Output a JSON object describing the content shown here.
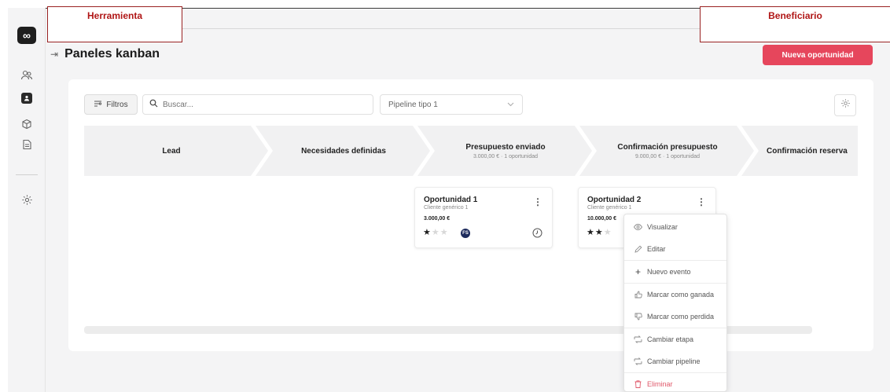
{
  "tags": {
    "left": "Herramienta",
    "right": "Beneficiario"
  },
  "sidebar": {
    "logo": "∞",
    "icons": [
      "contacts-icon",
      "user-card-icon",
      "package-icon",
      "document-icon",
      "settings-icon"
    ]
  },
  "header": {
    "title": "Paneles kanban",
    "new_button": "Nueva oportunidad"
  },
  "toolbar": {
    "filter_label": "Filtros",
    "search_placeholder": "Buscar...",
    "pipeline_value": "Pipeline tipo 1"
  },
  "stages": [
    {
      "name": "Lead",
      "sub": ""
    },
    {
      "name": "Necesidades definidas",
      "sub": ""
    },
    {
      "name": "Presupuesto enviado",
      "sub": "3.000,00 € · 1 oportunidad"
    },
    {
      "name": "Confirmación presupuesto",
      "sub": "9.000,00 € · 1 oportunidad"
    },
    {
      "name": "Confirmación reserva",
      "sub": ""
    }
  ],
  "cards": [
    {
      "title": "Oportunidad 1",
      "client": "Cliente genérico 1",
      "amount": "3.000,00 €",
      "stars": 1,
      "avatar": "FS"
    },
    {
      "title": "Oportunidad 2",
      "client": "Cliente genérico 1",
      "amount": "10.000,00 €",
      "stars": 2
    }
  ],
  "menu": [
    {
      "label": "Visualizar",
      "icon": "eye-icon"
    },
    {
      "label": "Editar",
      "icon": "pencil-icon"
    },
    {
      "label": "Nuevo evento",
      "icon": "plus-icon"
    },
    {
      "label": "Marcar como ganada",
      "icon": "thumbs-up-icon"
    },
    {
      "label": "Marcar como perdida",
      "icon": "thumbs-down-icon"
    },
    {
      "label": "Cambiar etapa",
      "icon": "swap-icon"
    },
    {
      "label": "Cambiar pipeline",
      "icon": "swap-icon"
    },
    {
      "label": "Eliminar",
      "icon": "trash-icon"
    }
  ],
  "colors": {
    "accent": "#e6465c",
    "tag": "#b01616",
    "avatar": "#1c2a5c"
  }
}
